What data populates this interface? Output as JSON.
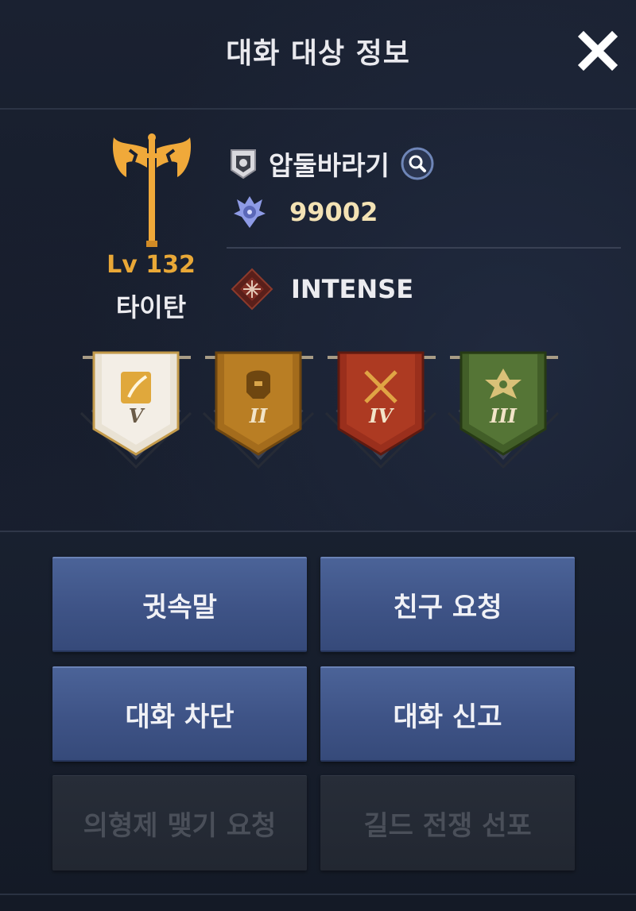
{
  "header": {
    "title": "대화 대상 정보"
  },
  "character": {
    "level": "Lv 132",
    "class_name": "타이탄",
    "class_icon": "axe-icon"
  },
  "profile": {
    "name": "압둘바라기",
    "name_icon": "guild-emblem-icon",
    "score": "99002",
    "score_icon": "horned-helm-icon",
    "title_text": "INTENSE",
    "title_icon": "diamond-emblem-icon"
  },
  "banners": [
    {
      "rank": "V",
      "icon": "feather-icon",
      "color": "#e8e0d2"
    },
    {
      "rank": "II",
      "icon": "helmet-icon",
      "color": "#b37a1e"
    },
    {
      "rank": "IV",
      "icon": "crossed-swords-icon",
      "color": "#a83a22"
    },
    {
      "rank": "III",
      "icon": "leaf-emblem-icon",
      "color": "#4d6b30"
    }
  ],
  "actions": {
    "whisper": "귓속말",
    "friend_request": "친구 요청",
    "block_chat": "대화 차단",
    "report_chat": "대화 신고",
    "sworn_brother": "의형제 맺기 요청",
    "guild_war": "길드 전쟁 선포"
  },
  "colors": {
    "accent_gold": "#e9a837",
    "button_blue": "#4b6398"
  }
}
